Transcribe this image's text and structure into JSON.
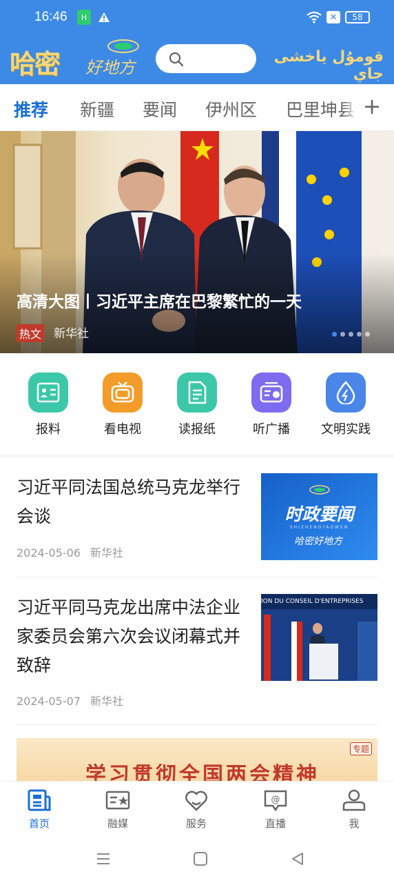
{
  "status_bar": {
    "time": "16:46",
    "battery": "58",
    "sim_label": "H"
  },
  "header": {
    "logo_text": "哈密",
    "logo_sub": "好地方",
    "search_placeholder": "",
    "uyghur_text": "قومۇل ياخشى جاي"
  },
  "tabs": {
    "items": [
      {
        "label": "推荐",
        "active": true
      },
      {
        "label": "新疆"
      },
      {
        "label": "要闻"
      },
      {
        "label": "伊州区"
      },
      {
        "label": "巴里坤县"
      }
    ],
    "plus": "+"
  },
  "banner": {
    "title": "高清大图丨习近平主席在巴黎繁忙的一天",
    "tag": "热文",
    "source": "新华社",
    "slide_count": 5,
    "active_slide": 0
  },
  "quick_links": [
    {
      "label": "报料",
      "icon": "report-icon",
      "color": "#3cc8a8"
    },
    {
      "label": "看电视",
      "icon": "tv-icon",
      "color": "#f39c2a"
    },
    {
      "label": "读报纸",
      "icon": "newspaper-icon",
      "color": "#3cc8a8"
    },
    {
      "label": "听广播",
      "icon": "radio-icon",
      "color": "#7e6cf0"
    },
    {
      "label": "文明实践",
      "icon": "droplet-icon",
      "color": "#4a86e8"
    }
  ],
  "news": [
    {
      "title": "习近平同法国总统马克龙举行会谈",
      "date": "2024-05-06",
      "source": "新华社",
      "thumb_title": "时政要闻",
      "thumb_sub": "SHIZHENGYAOWEN",
      "thumb_brand": "哈密好地方"
    },
    {
      "title": "习近平同马克龙出席中法企业家委员会第六次会议闭幕式并致辞",
      "date": "2024-05-07",
      "source": "新华社",
      "thumb_caption": "ION DU CONSEIL D'ENTREPRISES"
    }
  ],
  "promo": {
    "text": "学习贯彻全国两会精神",
    "badge": "专题"
  },
  "bottom_nav": [
    {
      "label": "首页",
      "icon": "home-news-icon",
      "active": true
    },
    {
      "label": "融媒",
      "icon": "media-card-icon"
    },
    {
      "label": "服务",
      "icon": "heart-service-icon"
    },
    {
      "label": "直播",
      "icon": "live-chat-icon"
    },
    {
      "label": "我",
      "icon": "user-icon"
    }
  ],
  "colors": {
    "brand_blue": "#3d8ae6",
    "active_blue": "#1a6fd1",
    "tag_red": "#c0392b"
  }
}
